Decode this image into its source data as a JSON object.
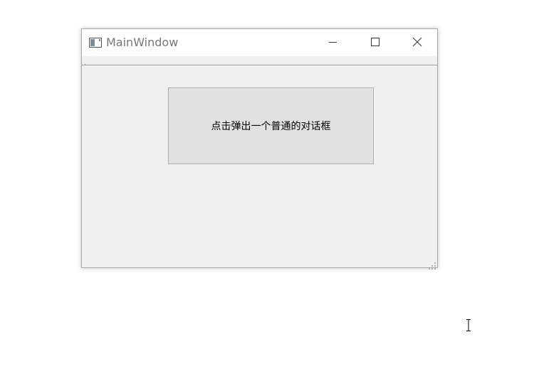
{
  "window": {
    "title": "MainWindow",
    "app_icon": "window-app-icon",
    "controls": [
      "minimize-icon",
      "maximize-icon",
      "close-icon"
    ]
  },
  "main": {
    "button_label": "点击弹出一个普通的对话框"
  },
  "colors": {
    "client_background": "#f0f0f0",
    "button_background": "#e1e1e1",
    "button_border": "#adadad",
    "title_text": "#777777"
  },
  "cursor": "text-cursor-icon"
}
